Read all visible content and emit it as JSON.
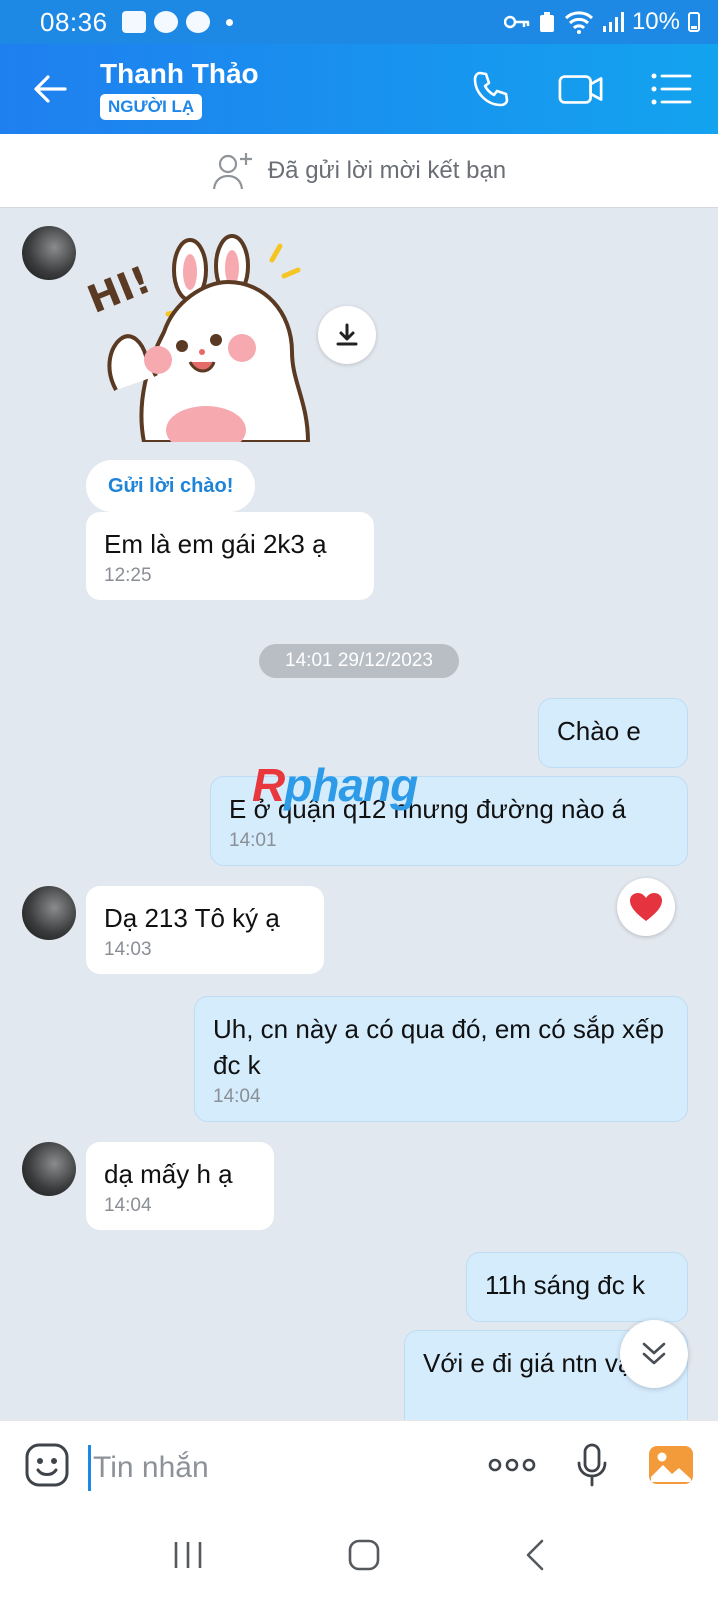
{
  "status_bar": {
    "time": "08:36",
    "battery": "10%"
  },
  "header": {
    "title": "Thanh Thảo",
    "badge": "NGƯỜI LẠ"
  },
  "friend_banner": {
    "text": "Đã gửi lời mời kết bạn"
  },
  "watermark": {
    "part1": "R",
    "part2": "phang"
  },
  "chat": {
    "greeting_button": "Gửi lời chào!",
    "date_separator": "14:01 29/12/2023",
    "messages": [
      {
        "dir": "in",
        "text": "Em là em gái 2k3 ạ",
        "time": "12:25"
      },
      {
        "dir": "out",
        "text": "Chào e",
        "time": ""
      },
      {
        "dir": "out",
        "text": "E ở quận q12 nhưng đường nào á",
        "time": "14:01"
      },
      {
        "dir": "in",
        "text": "Dạ 213 Tô ký ạ",
        "time": "14:03"
      },
      {
        "dir": "out",
        "text": "Uh, cn này a có qua đó, em có sắp xếp đc k",
        "time": "14:04"
      },
      {
        "dir": "in",
        "text": "dạ mấy h ạ",
        "time": "14:04"
      },
      {
        "dir": "out",
        "text": "11h sáng đc k",
        "time": ""
      },
      {
        "dir": "out",
        "text": "Với e đi giá ntn vạy",
        "time": ""
      }
    ]
  },
  "input": {
    "placeholder": "Tin nhắn"
  },
  "colors": {
    "header_start": "#1f7fef",
    "header_end": "#13a3ef",
    "outgoing_bubble": "#d5ecfd",
    "incoming_bubble": "#ffffff",
    "chat_bg": "#e2e8ef"
  }
}
